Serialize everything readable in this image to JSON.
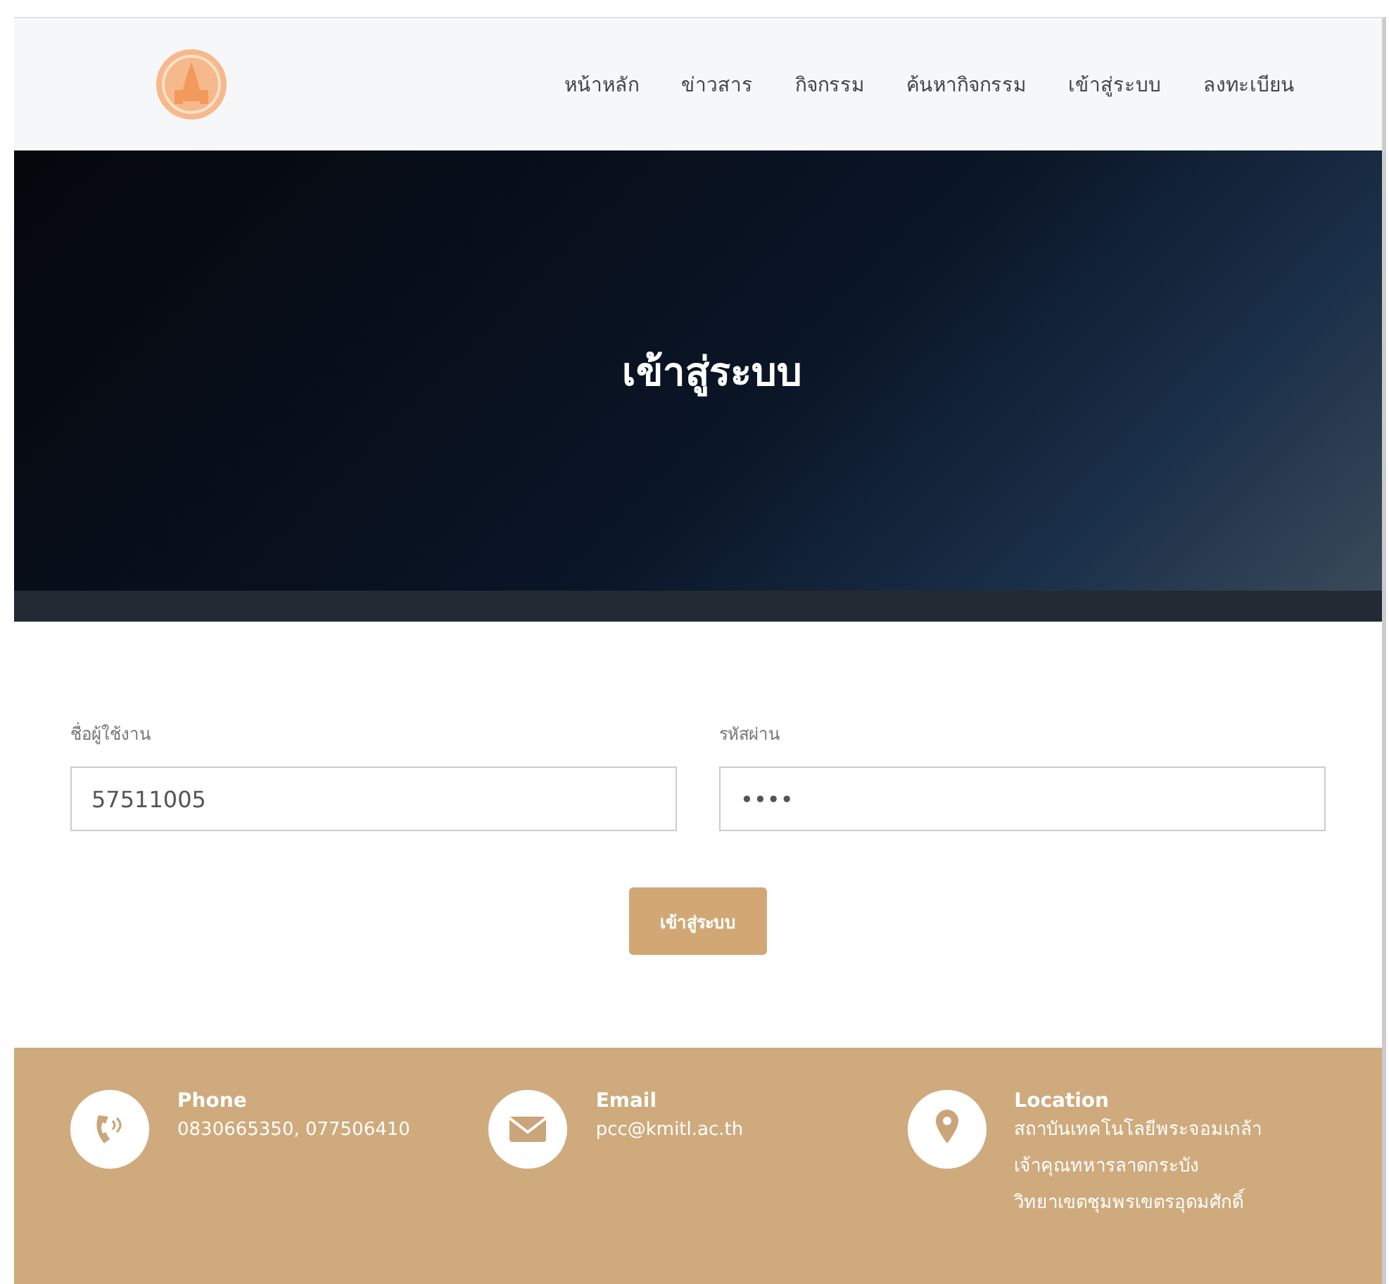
{
  "nav": {
    "items": [
      {
        "label": "หน้าหลัก"
      },
      {
        "label": "ข่าวสาร"
      },
      {
        "label": "กิจกรรม"
      },
      {
        "label": "ค้นหากิจกรรม"
      },
      {
        "label": "เข้าสู่ระบบ"
      },
      {
        "label": "ลงทะเบียน"
      }
    ]
  },
  "hero": {
    "title": "เข้าสู่ระบบ"
  },
  "form": {
    "fields": [
      {
        "label": "ชื่อผู้ใช้งาน",
        "value": "57511005"
      },
      {
        "label": "รหัสผ่าน",
        "value": "••••"
      }
    ],
    "submit": "เข้าสู่ระบบ"
  },
  "footer": {
    "contacts": [
      {
        "kind": "phone",
        "title": "Phone",
        "lines": [
          "0830665350, 077506410"
        ]
      },
      {
        "kind": "email",
        "title": "Email",
        "lines": [
          "pcc@kmitl.ac.th"
        ]
      },
      {
        "kind": "location",
        "title": "Location",
        "lines": [
          "สถาบันเทคโนโลยีพระจอมเกล้า",
          "เจ้าคุณทหารลาดกระบัง",
          "วิทยาเขตชุมพรเขตรอุดมศักดิ์"
        ]
      }
    ]
  }
}
